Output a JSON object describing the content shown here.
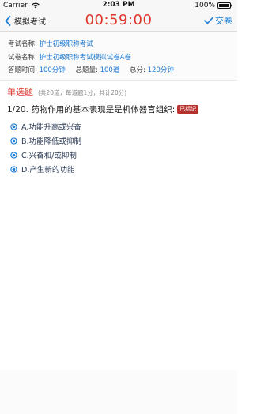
{
  "status_bar": {
    "carrier": "Carrier",
    "time": "2:03 PM",
    "battery": "100%"
  },
  "nav": {
    "back_label": "模拟考试",
    "timer": "00:59:00",
    "submit_label": "交卷"
  },
  "exam_info": {
    "name_label": "考试名称:",
    "name_value": "护士初级职称考试",
    "paper_label": "试卷名称:",
    "paper_value": "护士初级职称考试模拟试卷A卷",
    "time_label": "答题时间:",
    "time_value": "100分钟",
    "count_label": "总题量:",
    "count_value": "100道",
    "score_label": "总分:",
    "score_value": "120分钟"
  },
  "section": {
    "title": "单选题",
    "note": "(共20道，每道题1分，共计20分)"
  },
  "question": {
    "number": "1/20.",
    "text": "药物作用的基本表现是是机体器官组织:",
    "badge": "已标记",
    "options": [
      {
        "label": "A.功能升高或兴奋"
      },
      {
        "label": "B.功能降低或抑制"
      },
      {
        "label": "C.兴奋和/或抑制"
      },
      {
        "label": "D.产生新的功能"
      }
    ]
  },
  "colors": {
    "accent": "#1e7fd7",
    "timer": "#e0352b",
    "section_title": "#d9342b",
    "badge": "#b8312f"
  }
}
